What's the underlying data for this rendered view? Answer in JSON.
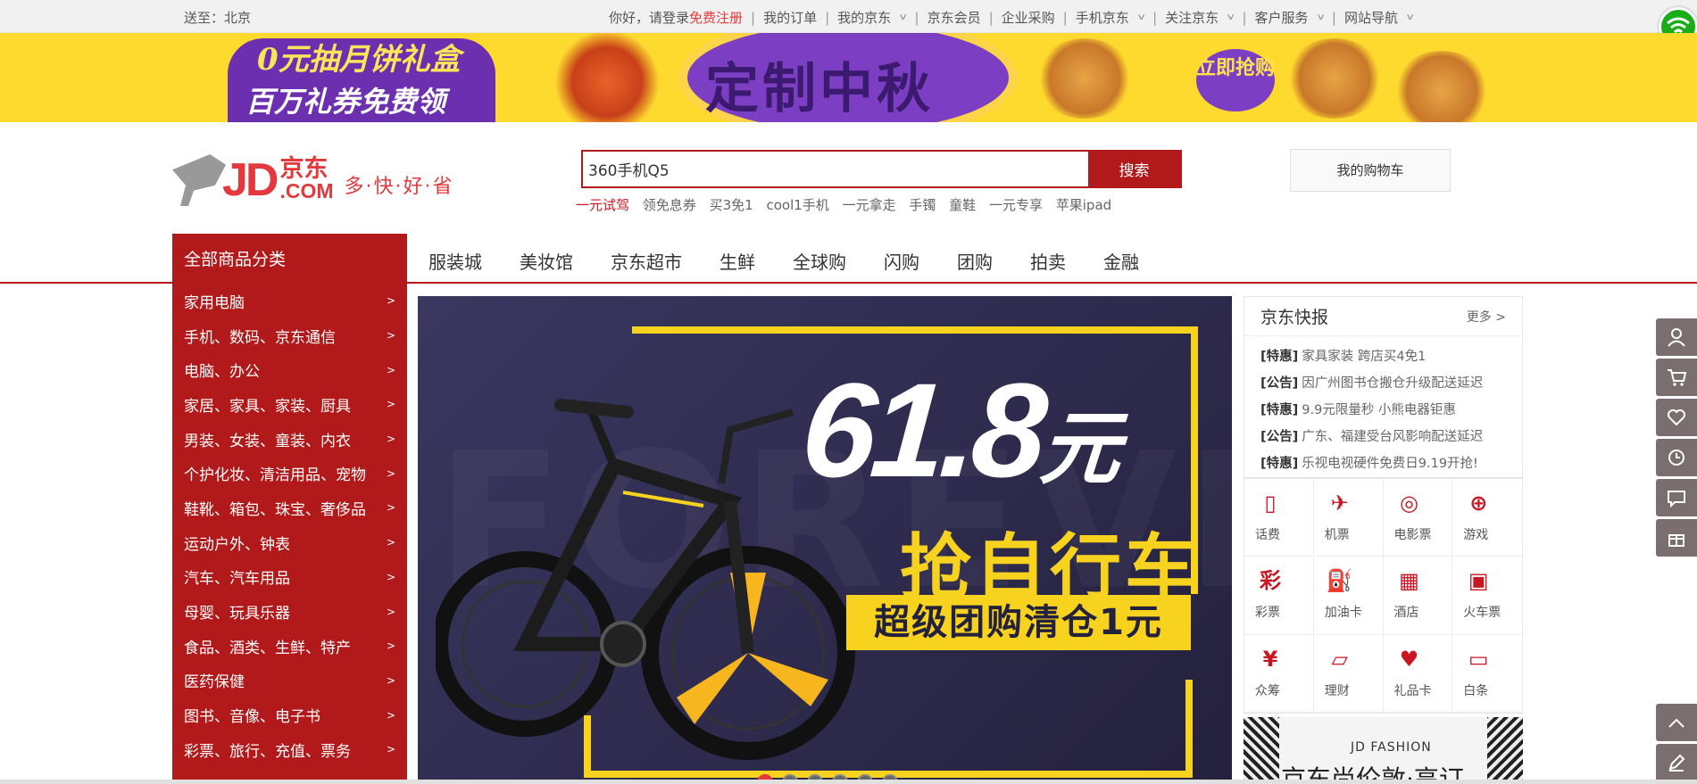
{
  "topbar": {
    "ship_to": "送至：北京",
    "greeting": "你好，请登录",
    "register": "免费注册",
    "links": [
      "我的订单",
      "我的京东",
      "京东会员",
      "企业采购",
      "手机京东",
      "关注京东",
      "客户服务",
      "网站导航"
    ]
  },
  "banner": {
    "line1": "0元抽月饼礼盒",
    "line2": "百万礼券免费领",
    "headline": "定制中秋",
    "cta": "立即抢购"
  },
  "logo": {
    "jd": "JD",
    "cn": "京东",
    "com": ".COM",
    "slogan": "多·快·好·省"
  },
  "search": {
    "value": "360手机Q5",
    "button": "搜索"
  },
  "hotwords": [
    "一元试驾",
    "领免息券",
    "买3免1",
    "cool1手机",
    "一元拿走",
    "手镯",
    "童鞋",
    "一元专享",
    "苹果ipad"
  ],
  "cart": {
    "label": "我的购物车"
  },
  "categories": {
    "title": "全部商品分类",
    "items": [
      "家用电脑",
      "手机、数码、京东通信",
      "电脑、办公",
      "家居、家具、家装、厨具",
      "男装、女装、童装、内衣",
      "个护化妆、清洁用品、宠物",
      "鞋靴、箱包、珠宝、奢侈品",
      "运动户外、钟表",
      "汽车、汽车用品",
      "母婴、玩具乐器",
      "食品、酒类、生鲜、特产",
      "医药保健",
      "图书、音像、电子书",
      "彩票、旅行、充值、票务"
    ],
    "arrow": ">"
  },
  "mainnav": [
    "服装城",
    "美妆馆",
    "京东超市",
    "生鲜",
    "全球购",
    "闪购",
    "团购",
    "拍卖",
    "金融"
  ],
  "hero": {
    "price": "61.8",
    "yuan": "元",
    "slogan": "抢自行车",
    "strip": "超级团购清仓1元",
    "watermark": "FOREVER"
  },
  "news": {
    "title": "京东快报",
    "more": "更多 >",
    "items": [
      {
        "tag": "[特惠]",
        "text": "家具家装 跨店买4免1"
      },
      {
        "tag": "[公告]",
        "text": "因广州图书仓搬仓升级配送延迟"
      },
      {
        "tag": "[特惠]",
        "text": "9.9元限量秒 小熊电器钜惠"
      },
      {
        "tag": "[公告]",
        "text": "广东、福建受台风影响配送延迟"
      },
      {
        "tag": "[特惠]",
        "text": "乐视电视硬件免费日9.19开抢!"
      }
    ]
  },
  "services": [
    {
      "label": "话费",
      "icon": "phone-recharge-icon"
    },
    {
      "label": "机票",
      "icon": "airplane-icon"
    },
    {
      "label": "电影票",
      "icon": "film-reel-icon"
    },
    {
      "label": "游戏",
      "icon": "gamepad-icon"
    },
    {
      "label": "彩票",
      "icon": "lottery-icon"
    },
    {
      "label": "加油卡",
      "icon": "fuel-pump-icon"
    },
    {
      "label": "酒店",
      "icon": "hotel-icon"
    },
    {
      "label": "火车票",
      "icon": "train-icon"
    },
    {
      "label": "众筹",
      "icon": "yen-coin-icon"
    },
    {
      "label": "理财",
      "icon": "document-icon"
    },
    {
      "label": "礼品卡",
      "icon": "gift-card-icon"
    },
    {
      "label": "白条",
      "icon": "credit-card-icon"
    }
  ],
  "fashion": {
    "brand": "JD FASHION",
    "headline": "京东尚伦敦·高订"
  },
  "colors": {
    "brand_red": "#b1191a",
    "accent_red": "#e4393c",
    "banner_yellow": "#fed92e",
    "hero_yellow": "#f7d21e"
  }
}
